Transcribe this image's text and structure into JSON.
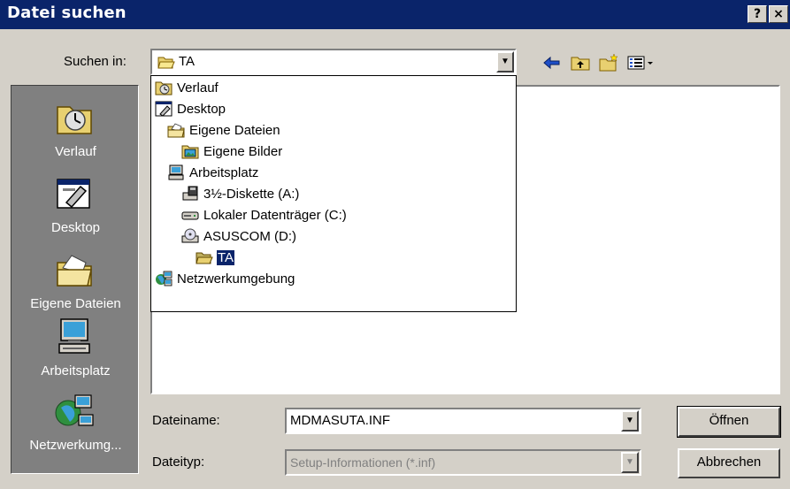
{
  "window": {
    "title": "Datei suchen",
    "help_label": "?",
    "close_label": "×"
  },
  "lookin": {
    "label": "Suchen in:",
    "value": "TA"
  },
  "toolbar": {
    "icons": [
      "back-arrow-icon",
      "up-folder-icon",
      "new-folder-icon",
      "view-menu-icon"
    ]
  },
  "places": [
    {
      "label": "Verlauf",
      "icon": "history-icon"
    },
    {
      "label": "Desktop",
      "icon": "desktop-icon"
    },
    {
      "label": "Eigene Dateien",
      "icon": "my-documents-icon"
    },
    {
      "label": "Arbeitsplatz",
      "icon": "my-computer-icon"
    },
    {
      "label": "Netzwerkumg...",
      "icon": "network-icon"
    }
  ],
  "dropdown": [
    {
      "label": "Verlauf",
      "icon": "history-icon",
      "selected": false
    },
    {
      "label": "Desktop",
      "icon": "desktop-icon",
      "selected": false
    },
    {
      "label": "Eigene Dateien",
      "icon": "my-documents-icon",
      "selected": false
    },
    {
      "label": "Eigene Bilder",
      "icon": "my-pictures-icon",
      "selected": false
    },
    {
      "label": "Arbeitsplatz",
      "icon": "my-computer-icon",
      "selected": false
    },
    {
      "label": "3½-Diskette (A:)",
      "icon": "floppy-icon",
      "selected": false
    },
    {
      "label": "Lokaler Datenträger (C:)",
      "icon": "hard-drive-icon",
      "selected": false
    },
    {
      "label": "ASUSCOM (D:)",
      "icon": "cd-drive-icon",
      "selected": false
    },
    {
      "label": "TA",
      "icon": "folder-open-icon",
      "selected": true
    },
    {
      "label": "Netzwerkumgebung",
      "icon": "network-icon",
      "selected": false
    }
  ],
  "filename": {
    "label": "Dateiname:",
    "value": "MDMASUTA.INF"
  },
  "filetype": {
    "label": "Dateityp:",
    "value": "Setup-Informationen (*.inf)"
  },
  "buttons": {
    "open": "Öffnen",
    "cancel": "Abbrechen"
  },
  "colors": {
    "titlebar": "#0a246a",
    "face": "#d4d0c8",
    "places_bg": "#808080",
    "selection": "#0a246a"
  }
}
